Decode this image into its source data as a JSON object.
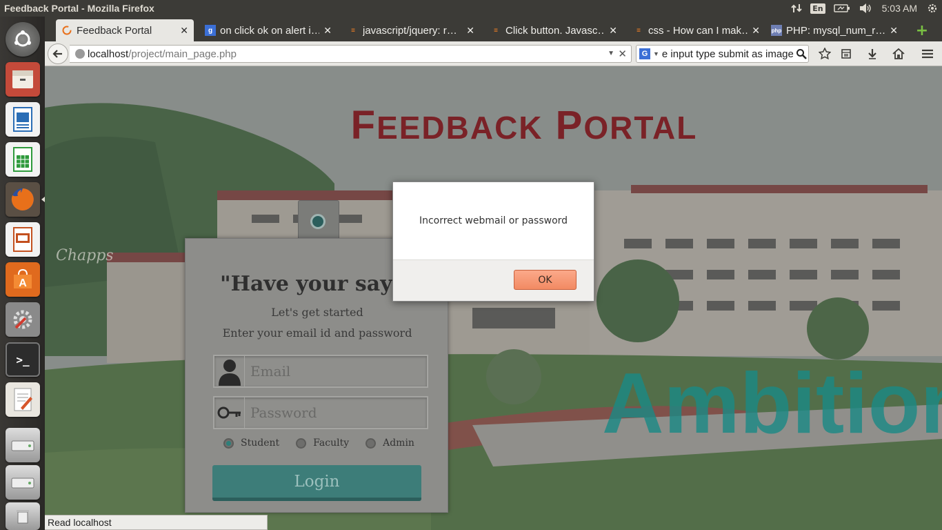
{
  "window": {
    "title": "Feedback Portal - Mozilla Firefox"
  },
  "tray": {
    "language": "En",
    "clock": "5:03 AM"
  },
  "launcher": {
    "items": [
      {
        "name": "ubuntu-dash",
        "color": "#d6562b"
      },
      {
        "name": "files",
        "color": "#c0392b"
      },
      {
        "name": "libreoffice-writer",
        "color": "#2a6db5"
      },
      {
        "name": "libreoffice-calc",
        "color": "#2e9a3c"
      },
      {
        "name": "firefox",
        "color": "#e8701a"
      },
      {
        "name": "libreoffice-impress",
        "color": "#c3501f"
      },
      {
        "name": "software-center",
        "color": "#e06a1e"
      },
      {
        "name": "system-settings",
        "color": "#6b6b6b"
      },
      {
        "name": "terminal",
        "color": "#2c2c2c"
      },
      {
        "name": "text-editor",
        "color": "#e9e6df"
      },
      {
        "name": "drive-1",
        "color": "#bcbcbc"
      },
      {
        "name": "drive-2",
        "color": "#bcbcbc"
      },
      {
        "name": "trash",
        "color": "#bcbcbc"
      }
    ]
  },
  "tabs": [
    {
      "title": "Feedback Portal",
      "favicon": "firefox",
      "active": true
    },
    {
      "title": "on click ok on alert i…",
      "favicon": "google",
      "active": false
    },
    {
      "title": "javascript/jquery: r…",
      "favicon": "stackoverflow",
      "active": false
    },
    {
      "title": "Click button. Javasc…",
      "favicon": "stackoverflow",
      "active": false
    },
    {
      "title": "css - How can I mak…",
      "favicon": "stackoverflow",
      "active": false
    },
    {
      "title": "PHP: mysql_num_r…",
      "favicon": "php",
      "active": false
    }
  ],
  "urlbar": {
    "host": "localhost",
    "path": "/project/main_page.php"
  },
  "searchbar": {
    "engine": "G",
    "text": "e input type submit as image"
  },
  "page": {
    "title_f": "F",
    "title_rest1": "EEDBACK",
    "title_p": "P",
    "title_rest2": "ORTAL",
    "watermark": "Ambition",
    "signature": "Chapps",
    "card": {
      "heading": "\"Have your say",
      "subtitle": "Let's get started",
      "instruction": "Enter your email id and password",
      "email_placeholder": "Email",
      "password_placeholder": "Password",
      "roles": [
        {
          "label": "Student",
          "selected": true
        },
        {
          "label": "Faculty",
          "selected": false
        },
        {
          "label": "Admin",
          "selected": false
        }
      ],
      "login_label": "Login"
    }
  },
  "status": {
    "text": "Read localhost"
  },
  "alert": {
    "message": "Incorrect webmail or password",
    "ok_label": "OK"
  }
}
